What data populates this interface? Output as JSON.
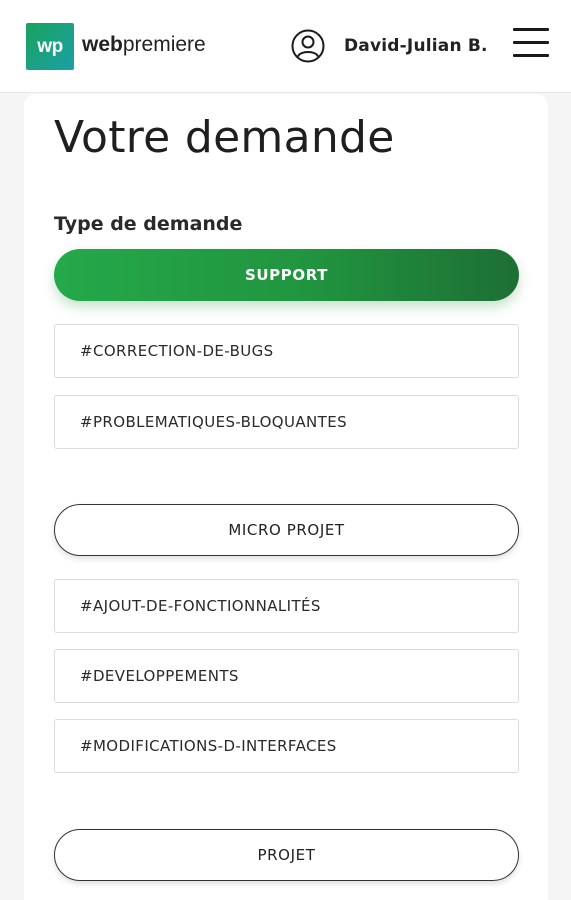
{
  "header": {
    "logo_mark": "wp",
    "brand_bold": "web",
    "brand_light": "premiere",
    "user_name": "David-Julian B.",
    "user_icon": "user-circle-icon",
    "menu_icon": "hamburger-menu-icon"
  },
  "main": {
    "title": "Votre demande",
    "section_label": "Type de demande",
    "groups": [
      {
        "label": "SUPPORT",
        "selected": true,
        "tags": [
          "#CORRECTION-DE-BUGS",
          "#PROBLEMATIQUES-BLOQUANTES"
        ]
      },
      {
        "label": "MICRO PROJET",
        "selected": false,
        "tags": [
          "#AJOUT-DE-FONCTIONNALITÉS",
          "#DEVELOPPEMENTS",
          "#MODIFICATIONS-D-INTERFACES"
        ]
      },
      {
        "label": "PROJET",
        "selected": false,
        "tags": []
      }
    ]
  },
  "colors": {
    "accent_green": "#25a84a",
    "accent_green_dark": "#1d6f34",
    "logo_gradient_start": "#19a35b",
    "logo_gradient_end": "#1aa0a8"
  }
}
